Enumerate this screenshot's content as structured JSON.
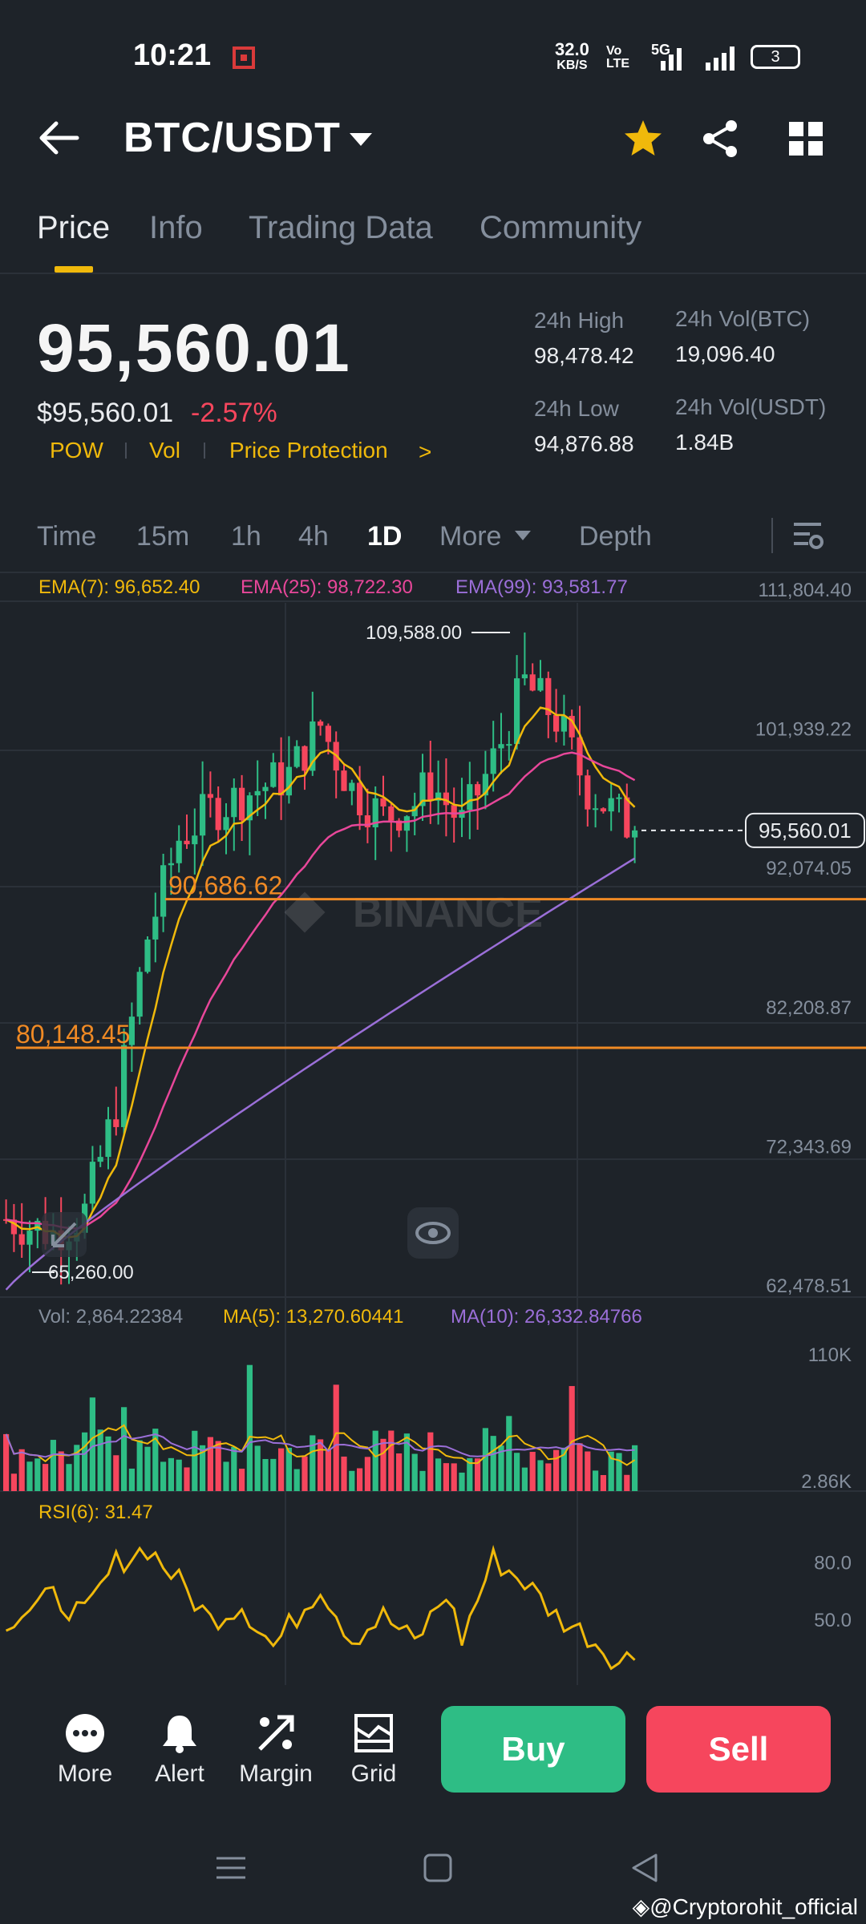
{
  "status_bar": {
    "time": "10:21",
    "speed_value": "32.0",
    "speed_unit": "KB/S",
    "volte_top": "Vo",
    "volte_bottom": "LTE",
    "network": "5G",
    "battery": "3"
  },
  "header": {
    "pair": "BTC/USDT"
  },
  "tabs": [
    {
      "label": "Price",
      "active": true
    },
    {
      "label": "Info",
      "active": false
    },
    {
      "label": "Trading Data",
      "active": false
    },
    {
      "label": "Community",
      "active": false
    }
  ],
  "price": {
    "last": "95,560.01",
    "usd": "$95,560.01",
    "change": "-2.57%",
    "badges": [
      "POW",
      "Vol",
      "Price Protection"
    ],
    "chevron": ">"
  },
  "stats": {
    "high_label": "24h High",
    "high_value": "98,478.42",
    "low_label": "24h Low",
    "low_value": "94,876.88",
    "vol_btc_label": "24h Vol(BTC)",
    "vol_btc_value": "19,096.40",
    "vol_usdt_label": "24h Vol(USDT)",
    "vol_usdt_value": "1.84B"
  },
  "timeframes": {
    "items": [
      {
        "label": "Time",
        "active": false
      },
      {
        "label": "15m",
        "active": false
      },
      {
        "label": "1h",
        "active": false
      },
      {
        "label": "4h",
        "active": false
      },
      {
        "label": "1D",
        "active": true
      },
      {
        "label": "More",
        "active": false
      },
      {
        "label": "Depth",
        "active": false
      }
    ]
  },
  "indicators": {
    "ema7": "EMA(7): 96,652.40",
    "ema25": "EMA(25): 98,722.30",
    "ema99": "EMA(99): 93,581.77",
    "vol": "Vol: 2,864.22384",
    "ma5": "MA(5): 13,270.60441",
    "ma10": "MA(10): 26,332.84766",
    "rsi": "RSI(6): 31.47"
  },
  "colors": {
    "up": "#2ebd85",
    "down": "#f6465d",
    "ema7": "#f0b90b",
    "ema25": "#e8479a",
    "ema99": "#9b6fd8",
    "accent": "#f0b90b",
    "hline": "#f08a24"
  },
  "chart_data": {
    "type": "candlestick",
    "price_axis_ticks": [
      "111,804.40",
      "101,939.22",
      "92,074.05",
      "82,208.87",
      "72,343.69",
      "62,478.51"
    ],
    "price_ylim": [
      62478.51,
      111804.4
    ],
    "current_price_tag": "95,560.01",
    "current_price": 95560.01,
    "high_annotation": "109,588.00",
    "high_value": 109588.0,
    "low_annotation": "65,260.00",
    "low_value": 65260.0,
    "horizontal_lines": [
      {
        "label": "90,686.62",
        "value": 90686.62
      },
      {
        "label": "80,148.45",
        "value": 80148.45
      }
    ],
    "volume_axis_ticks": [
      "110K",
      "2.86K"
    ],
    "rsi_axis_ticks": [
      "80.0",
      "50.0"
    ],
    "watermark": "BINANCE"
  },
  "bottom_bar": {
    "more": "More",
    "alert": "Alert",
    "margin": "Margin",
    "grid": "Grid",
    "buy": "Buy",
    "sell": "Sell"
  },
  "credit": "@Cryptorohit_official"
}
